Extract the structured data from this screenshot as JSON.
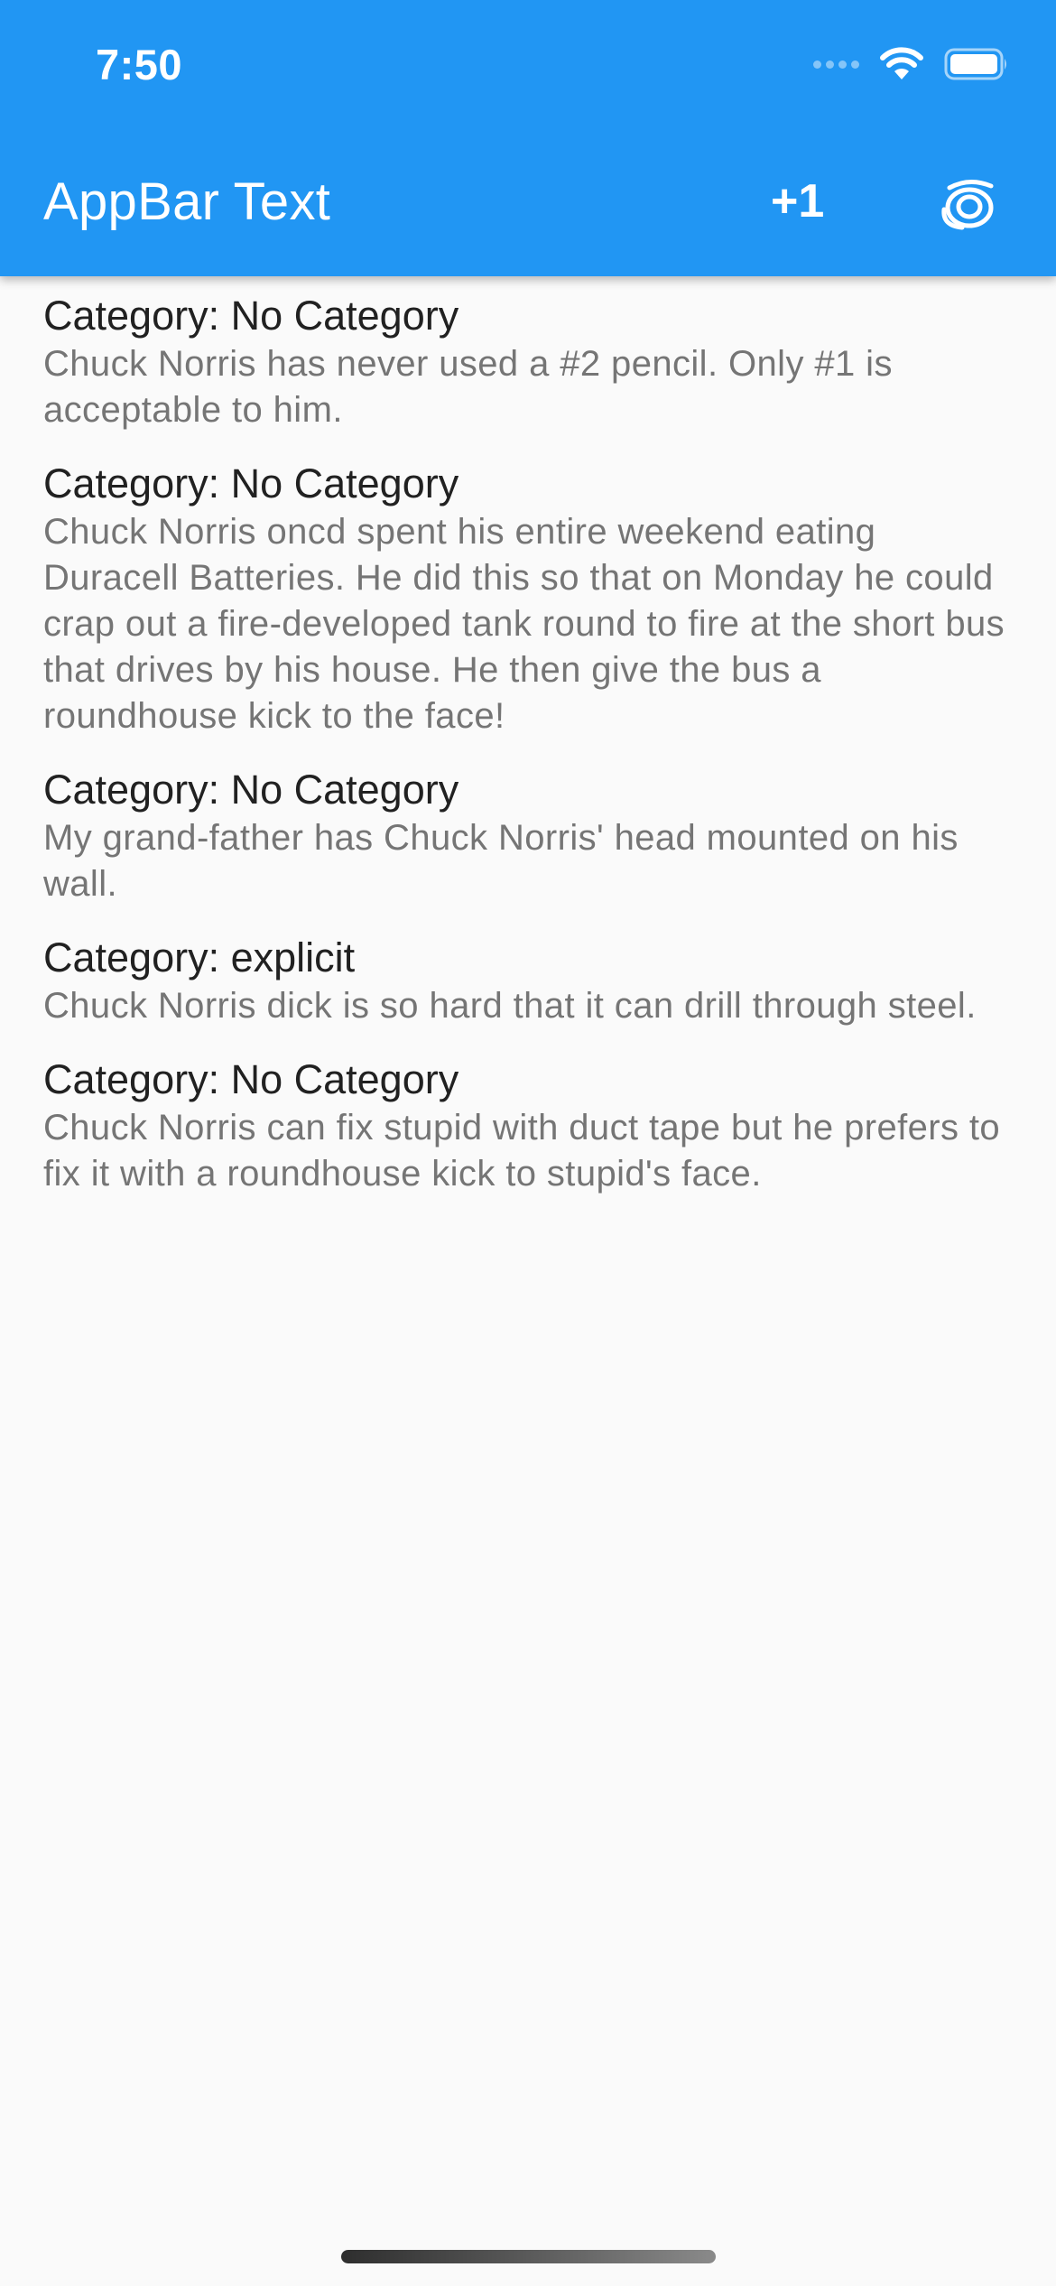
{
  "status_bar": {
    "time": "7:50"
  },
  "app_bar": {
    "title": "AppBar Text",
    "plus_one_label": "+1",
    "action_icon": "vortex-icon",
    "color": "#2196f3"
  },
  "jokes": [
    {
      "category": "Category: No Category",
      "text": "Chuck Norris has never used a #2 pencil. Only #1 is acceptable to him."
    },
    {
      "category": "Category: No Category",
      "text": "Chuck Norris oncd spent his entire weekend eating Duracell Batteries. He did this so that on Monday he could crap out a fire-developed tank round to fire at the short bus that drives by his house. He then give the bus a roundhouse kick to the face!"
    },
    {
      "category": "Category: No Category",
      "text": "My grand-father has Chuck Norris' head mounted on his wall."
    },
    {
      "category": "Category: explicit",
      "text": "Chuck Norris dick is so hard that it can drill through steel."
    },
    {
      "category": "Category: No Category",
      "text": "Chuck Norris can fix stupid with duct tape but he prefers to fix it with a roundhouse kick to stupid's face."
    }
  ]
}
